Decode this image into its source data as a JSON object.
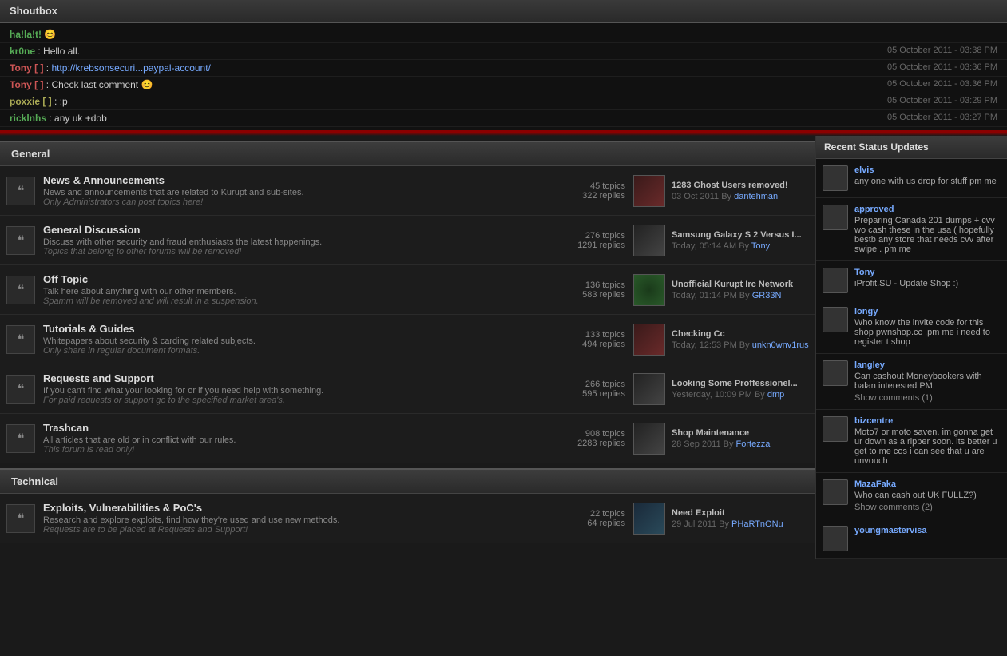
{
  "shoutbox": {
    "title": "Shoutbox",
    "messages": [
      {
        "user": "ha!la!t!",
        "user_class": "green",
        "msg": "",
        "timestamp": ""
      },
      {
        "user": "kr0ne",
        "user_class": "green",
        "msg": "Hello all.",
        "timestamp": "05 October 2011 - 03:38 PM"
      },
      {
        "user": "Tony [ ]",
        "user_class": "red",
        "msg_link": "http://krebsonsecuri...paypal-account/",
        "msg_link_href": "#",
        "timestamp": "05 October 2011 - 03:36 PM"
      },
      {
        "user": "Tony [ ]",
        "user_class": "red",
        "msg": "Check last comment 😊",
        "timestamp": "05 October 2011 - 03:36 PM"
      },
      {
        "user": "poxxie [ ]",
        "user_class": "yellow",
        "msg": ":p",
        "timestamp": "05 October 2011 - 03:29 PM"
      },
      {
        "user": "ricklnhs",
        "user_class": "green",
        "msg": "any uk +dob",
        "timestamp": "05 October 2011 - 03:27 PM"
      }
    ]
  },
  "sections": [
    {
      "label": "General",
      "forums": [
        {
          "title": "News & Announcements",
          "desc": "News and announcements that are related to Kurupt and sub-sites.",
          "desc_italic": "Only Administrators can post topics here!",
          "topics": "45 topics",
          "replies": "322 replies",
          "last_title": "1283 Ghost Users removed!",
          "last_date": "03 Oct 2011",
          "last_by": "By",
          "last_user": "dantehman",
          "img_type": "red"
        },
        {
          "title": "General Discussion",
          "desc": "Discuss with other security and fraud enthusiasts the latest happenings.",
          "desc_italic": "Topics that belong to other forums will be removed!",
          "topics": "276 topics",
          "replies": "1291 replies",
          "last_title": "Samsung Galaxy S 2 Versus I...",
          "last_date": "Today, 05:14 AM",
          "last_by": "By",
          "last_user": "Tony",
          "img_type": "dark"
        },
        {
          "title": "Off Topic",
          "desc": "Talk here about anything with our other members.",
          "desc_italic": "Spamm will be removed and will result in a suspension.",
          "topics": "136 topics",
          "replies": "583 replies",
          "last_title": "Unofficial Kurupt Irc Network",
          "last_date": "Today, 01:14 PM",
          "last_by": "By",
          "last_user": "GR33N",
          "img_type": "green"
        },
        {
          "title": "Tutorials & Guides",
          "desc": "Whitepapers about security & carding related subjects.",
          "desc_italic": "Only share in regular document formats.",
          "topics": "133 topics",
          "replies": "494 replies",
          "last_title": "Checking Cc",
          "last_date": "Today, 12:53 PM",
          "last_by": "By",
          "last_user": "unkn0wnv1rus",
          "img_type": "red"
        },
        {
          "title": "Requests and Support",
          "desc": "If you can't find what your looking for or if you need help with something.",
          "desc_italic": "For paid requests or support go to the specified market area's.",
          "topics": "266 topics",
          "replies": "595 replies",
          "last_title": "Looking Some Proffessionel...",
          "last_date": "Yesterday, 10:09 PM",
          "last_by": "By",
          "last_user": "dmp",
          "img_type": "dark"
        },
        {
          "title": "Trashcan",
          "desc": "All articles that are old or in conflict with our rules.",
          "desc_italic": "This forum is read only!",
          "topics": "908 topics",
          "replies": "2283 replies",
          "last_title": "Shop Maintenance",
          "last_date": "28 Sep 2011",
          "last_by": "By",
          "last_user": "Fortezza",
          "img_type": "dark"
        }
      ]
    },
    {
      "label": "Technical",
      "forums": [
        {
          "title": "Exploits, Vulnerabilities & PoC's",
          "desc": "Research and explore exploits, find how they're used and use new methods.",
          "desc_italic": "Requests are to be placed at Requests and Support!",
          "topics": "22 topics",
          "replies": "64 replies",
          "last_title": "Need Exploit",
          "last_date": "29 Jul 2011",
          "last_by": "By",
          "last_user": "PHaRTnONu",
          "img_type": "tech"
        }
      ]
    }
  ],
  "sidebar": {
    "title": "Recent Status Updates",
    "items": [
      {
        "username": "elvis",
        "text": "any one with us drop for stuff pm me",
        "show_comments": null
      },
      {
        "username": "approved",
        "text": "Preparing Canada 201 dumps + cvv wo cash these in the usa ( hopefully bestb any store that needs cvv after swipe . pm me",
        "show_comments": null
      },
      {
        "username": "Tony",
        "text": "iProfit.SU - Update Shop :)",
        "show_comments": null
      },
      {
        "username": "longy",
        "text": "Who know the invite code for this shop pwnshop.cc ,pm me i need to register t shop",
        "show_comments": null
      },
      {
        "username": "langley",
        "text": "Can cashout Moneybookers with balan interested PM.",
        "show_comments": "Show comments (1)"
      },
      {
        "username": "bizcentre",
        "text": "Moto7 or moto saven. im gonna get ur down as a ripper soon. its better u get to me cos i can see that u are unvouch",
        "show_comments": null
      },
      {
        "username": "MazaFaka",
        "text": "Who can cash out UK FULLZ?)",
        "show_comments": "Show comments (2)"
      },
      {
        "username": "youngmastervisa",
        "text": "",
        "show_comments": null
      }
    ]
  }
}
